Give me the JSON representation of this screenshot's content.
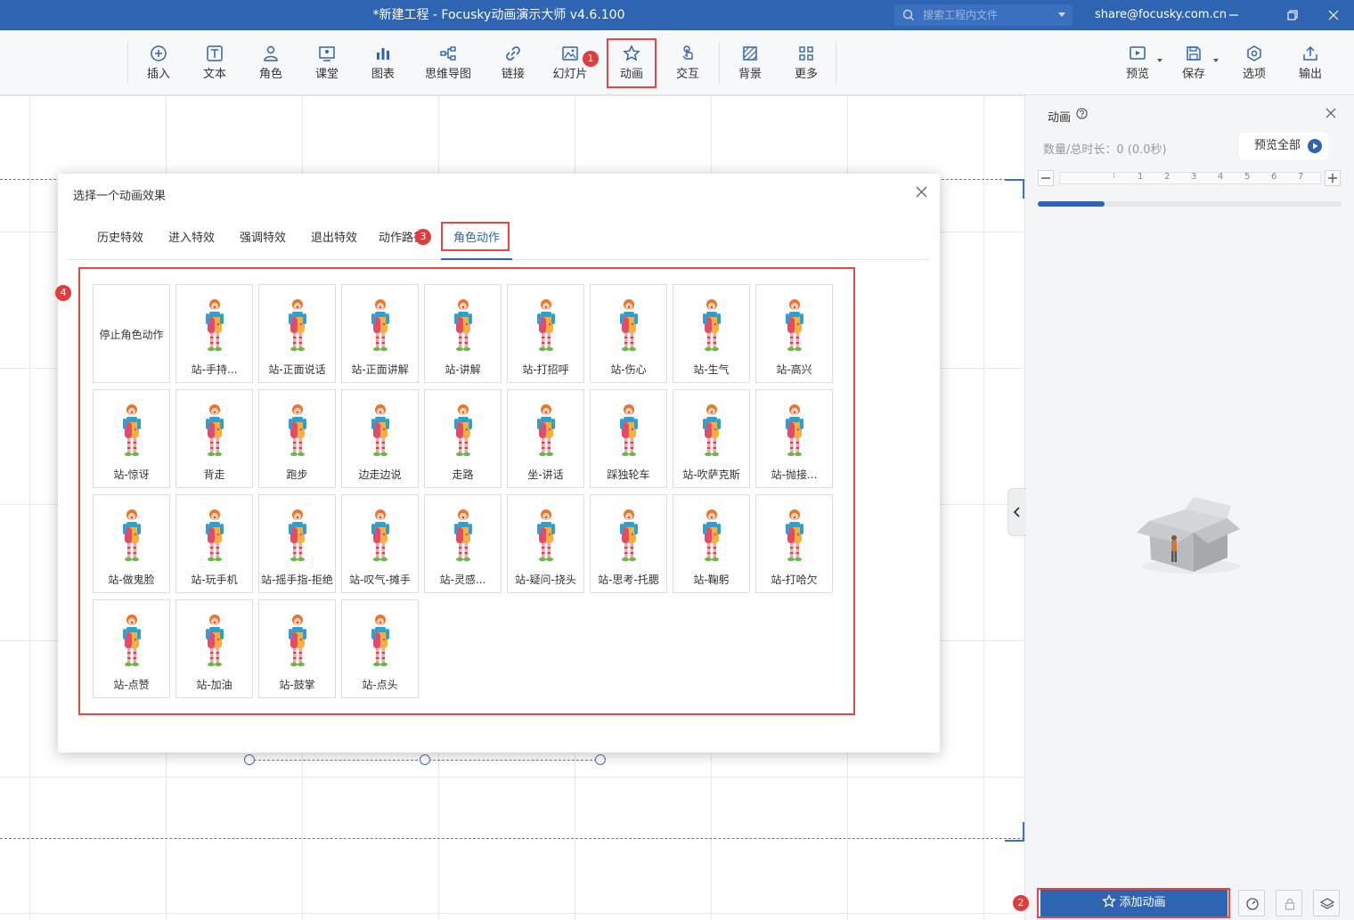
{
  "window": {
    "title": "*新建工程 - Focusky动画演示大师  v4.6.100",
    "search_placeholder": "搜索工程内文件",
    "account": "share@focusky.com.cn"
  },
  "toolbar": {
    "items": [
      {
        "label": "插入",
        "icon": "plus-circle-icon"
      },
      {
        "label": "文本",
        "icon": "text-icon"
      },
      {
        "label": "角色",
        "icon": "character-icon"
      },
      {
        "label": "课堂",
        "icon": "classroom-icon"
      },
      {
        "label": "图表",
        "icon": "chart-icon"
      },
      {
        "label": "思维导图",
        "icon": "mindmap-icon"
      },
      {
        "label": "链接",
        "icon": "link-icon"
      },
      {
        "label": "幻灯片",
        "icon": "slide-icon"
      },
      {
        "label": "动画",
        "icon": "star-icon"
      },
      {
        "label": "交互",
        "icon": "touch-icon"
      },
      {
        "label": "背景",
        "icon": "background-icon"
      },
      {
        "label": "更多",
        "icon": "more-icon"
      }
    ],
    "right_items": [
      {
        "label": "预览",
        "icon": "preview-icon"
      },
      {
        "label": "保存",
        "icon": "save-icon"
      },
      {
        "label": "选项",
        "icon": "options-icon"
      },
      {
        "label": "输出",
        "icon": "export-icon"
      }
    ]
  },
  "annotations": [
    "1",
    "2",
    "3",
    "4"
  ],
  "dialog": {
    "title": "选择一个动画效果",
    "tabs": [
      "历史特效",
      "进入特效",
      "强调特效",
      "退出特效",
      "动作路径",
      "角色动作"
    ],
    "active_tab": "角色动作",
    "stop_tile": "停止角色动作",
    "actions": [
      "站-手持...",
      "站-正面说话",
      "站-正面讲解",
      "站-讲解",
      "站-打招呼",
      "站-伤心",
      "站-生气",
      "站-高兴",
      "站-惊讶",
      "背走",
      "跑步",
      "边走边说",
      "走路",
      "坐-讲话",
      "踩独轮车",
      "站-吹萨克斯",
      "站-抛接...",
      "站-做鬼脸",
      "站-玩手机",
      "站-摇手指-拒绝",
      "站-叹气-摊手",
      "站-灵感...",
      "站-疑问-挠头",
      "站-思考-托腮",
      "站-鞠躬",
      "站-打哈欠",
      "站-点赞",
      "站-加油",
      "站-鼓掌",
      "站-点头"
    ]
  },
  "panel": {
    "title": "动画",
    "count_label": "数量/总时长：0 (0.0秒)",
    "preview_all": "预览全部",
    "ruler_ticks": [
      "1",
      "2",
      "3",
      "4",
      "5",
      "6",
      "7"
    ],
    "progress": 0.22,
    "add_button": "添加动画"
  },
  "colors": {
    "brand": "#2f64b3",
    "highlight": "#e84545"
  }
}
